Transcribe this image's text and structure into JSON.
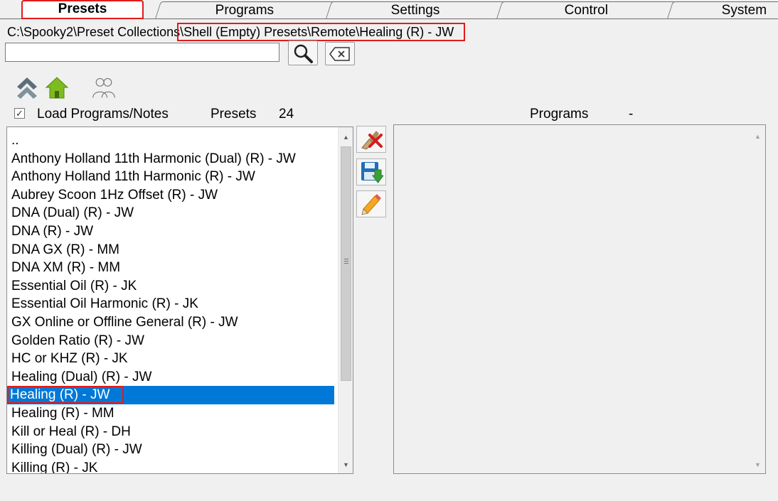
{
  "tabs": [
    {
      "label": "Presets",
      "active": true
    },
    {
      "label": "Programs",
      "active": false
    },
    {
      "label": "Settings",
      "active": false
    },
    {
      "label": "Control",
      "active": false
    },
    {
      "label": "System",
      "active": false
    }
  ],
  "path": {
    "prefix": "C:\\Spooky2\\Preset Collections",
    "highlighted": "\\Shell (Empty) Presets\\Remote\\Healing (R) - JW"
  },
  "search": {
    "value": "",
    "placeholder": ""
  },
  "icons": {
    "search": "search-icon",
    "clear": "clear-backspace-icon",
    "up": "double-chevron-up-icon",
    "home": "home-icon",
    "users": "users-icon",
    "delete": "delete-preset-icon",
    "save": "save-preset-icon",
    "edit": "edit-preset-icon"
  },
  "load_programs": {
    "label": "Load Programs/Notes",
    "checked": true
  },
  "presets_header": {
    "label": "Presets",
    "count": "24"
  },
  "programs_header": {
    "label": "Programs",
    "count": "-"
  },
  "preset_list": [
    "..",
    "Anthony Holland 11th Harmonic (Dual) (R) - JW",
    "Anthony Holland 11th Harmonic (R) - JW",
    "Aubrey Scoon 1Hz Offset (R) - JW",
    "DNA (Dual) (R) - JW",
    "DNA (R) - JW",
    "DNA GX (R) - MM",
    "DNA XM (R) - MM",
    "Essential Oil (R) - JK",
    "Essential Oil Harmonic (R) - JK",
    "GX Online or Offline General (R) - JW",
    "Golden Ratio (R) - JW",
    "HC or KHZ (R) - JK",
    "Healing (Dual) (R) - JW",
    "Healing (R) - JW",
    "Healing (R) - MM",
    "Kill or Heal (R) - DH",
    "Killing (Dual) (R) - JW",
    "Killing (R) - JK"
  ],
  "selected_index": 14,
  "colors": {
    "selection": "#0078d7",
    "highlight_outline": "#e21b1b"
  }
}
